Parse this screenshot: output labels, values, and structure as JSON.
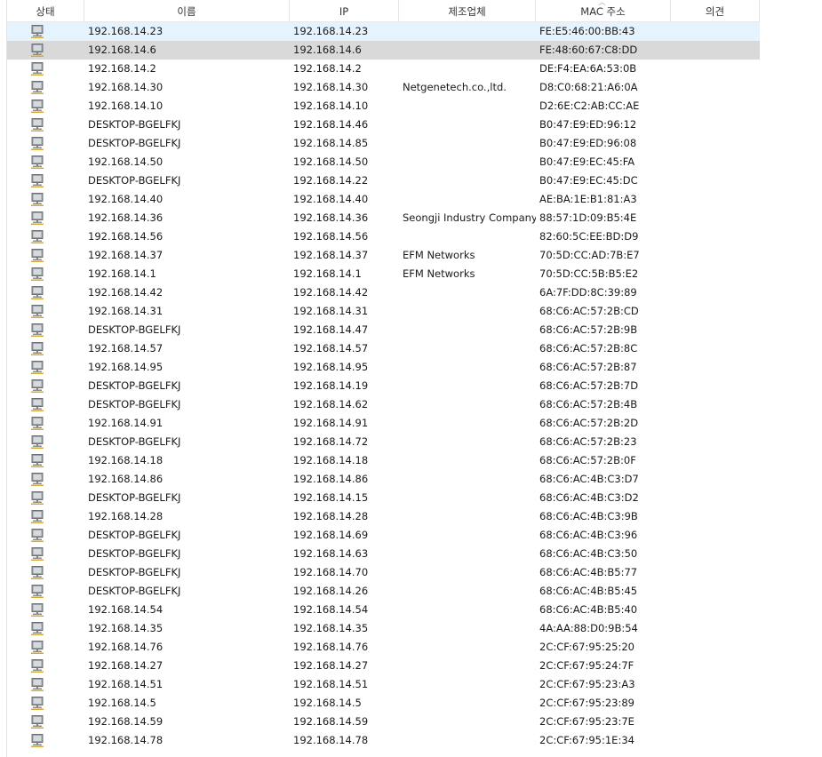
{
  "columns": {
    "status": "상태",
    "name": "이름",
    "ip": "IP",
    "vendor": "제조업체",
    "mac": "MAC 주소",
    "note": "의견"
  },
  "sort_indicator": "︿",
  "status_icon_name": "network-computer-icon",
  "rows": [
    {
      "name": "192.168.14.23",
      "ip": "192.168.14.23",
      "vendor": "",
      "mac": "FE:E5:46:00:BB:43",
      "note": "",
      "state": "hover"
    },
    {
      "name": "192.168.14.6",
      "ip": "192.168.14.6",
      "vendor": "",
      "mac": "FE:48:60:67:C8:DD",
      "note": "",
      "state": "selected"
    },
    {
      "name": "192.168.14.2",
      "ip": "192.168.14.2",
      "vendor": "",
      "mac": "DE:F4:EA:6A:53:0B",
      "note": ""
    },
    {
      "name": "192.168.14.30",
      "ip": "192.168.14.30",
      "vendor": "Netgenetech.co.,ltd.",
      "mac": "D8:C0:68:21:A6:0A",
      "note": ""
    },
    {
      "name": "192.168.14.10",
      "ip": "192.168.14.10",
      "vendor": "",
      "mac": "D2:6E:C2:AB:CC:AE",
      "note": ""
    },
    {
      "name": "DESKTOP-BGELFKJ",
      "ip": "192.168.14.46",
      "vendor": "",
      "mac": "B0:47:E9:ED:96:12",
      "note": ""
    },
    {
      "name": "DESKTOP-BGELFKJ",
      "ip": "192.168.14.85",
      "vendor": "",
      "mac": "B0:47:E9:ED:96:08",
      "note": ""
    },
    {
      "name": "192.168.14.50",
      "ip": "192.168.14.50",
      "vendor": "",
      "mac": "B0:47:E9:EC:45:FA",
      "note": ""
    },
    {
      "name": "DESKTOP-BGELFKJ",
      "ip": "192.168.14.22",
      "vendor": "",
      "mac": "B0:47:E9:EC:45:DC",
      "note": ""
    },
    {
      "name": "192.168.14.40",
      "ip": "192.168.14.40",
      "vendor": "",
      "mac": "AE:BA:1E:B1:81:A3",
      "note": ""
    },
    {
      "name": "192.168.14.36",
      "ip": "192.168.14.36",
      "vendor": "Seongji Industry Company",
      "mac": "88:57:1D:09:B5:4E",
      "note": ""
    },
    {
      "name": "192.168.14.56",
      "ip": "192.168.14.56",
      "vendor": "",
      "mac": "82:60:5C:EE:BD:D9",
      "note": ""
    },
    {
      "name": "192.168.14.37",
      "ip": "192.168.14.37",
      "vendor": "EFM Networks",
      "mac": "70:5D:CC:AD:7B:E7",
      "note": ""
    },
    {
      "name": "192.168.14.1",
      "ip": "192.168.14.1",
      "vendor": "EFM Networks",
      "mac": "70:5D:CC:5B:B5:E2",
      "note": ""
    },
    {
      "name": "192.168.14.42",
      "ip": "192.168.14.42",
      "vendor": "",
      "mac": "6A:7F:DD:8C:39:89",
      "note": ""
    },
    {
      "name": "192.168.14.31",
      "ip": "192.168.14.31",
      "vendor": "",
      "mac": "68:C6:AC:57:2B:CD",
      "note": ""
    },
    {
      "name": "DESKTOP-BGELFKJ",
      "ip": "192.168.14.47",
      "vendor": "",
      "mac": "68:C6:AC:57:2B:9B",
      "note": ""
    },
    {
      "name": "192.168.14.57",
      "ip": "192.168.14.57",
      "vendor": "",
      "mac": "68:C6:AC:57:2B:8C",
      "note": ""
    },
    {
      "name": "192.168.14.95",
      "ip": "192.168.14.95",
      "vendor": "",
      "mac": "68:C6:AC:57:2B:87",
      "note": ""
    },
    {
      "name": "DESKTOP-BGELFKJ",
      "ip": "192.168.14.19",
      "vendor": "",
      "mac": "68:C6:AC:57:2B:7D",
      "note": ""
    },
    {
      "name": "DESKTOP-BGELFKJ",
      "ip": "192.168.14.62",
      "vendor": "",
      "mac": "68:C6:AC:57:2B:4B",
      "note": ""
    },
    {
      "name": "192.168.14.91",
      "ip": "192.168.14.91",
      "vendor": "",
      "mac": "68:C6:AC:57:2B:2D",
      "note": ""
    },
    {
      "name": "DESKTOP-BGELFKJ",
      "ip": "192.168.14.72",
      "vendor": "",
      "mac": "68:C6:AC:57:2B:23",
      "note": ""
    },
    {
      "name": "192.168.14.18",
      "ip": "192.168.14.18",
      "vendor": "",
      "mac": "68:C6:AC:57:2B:0F",
      "note": ""
    },
    {
      "name": "192.168.14.86",
      "ip": "192.168.14.86",
      "vendor": "",
      "mac": "68:C6:AC:4B:C3:D7",
      "note": ""
    },
    {
      "name": "DESKTOP-BGELFKJ",
      "ip": "192.168.14.15",
      "vendor": "",
      "mac": "68:C6:AC:4B:C3:D2",
      "note": ""
    },
    {
      "name": "192.168.14.28",
      "ip": "192.168.14.28",
      "vendor": "",
      "mac": "68:C6:AC:4B:C3:9B",
      "note": ""
    },
    {
      "name": "DESKTOP-BGELFKJ",
      "ip": "192.168.14.69",
      "vendor": "",
      "mac": "68:C6:AC:4B:C3:96",
      "note": ""
    },
    {
      "name": "DESKTOP-BGELFKJ",
      "ip": "192.168.14.63",
      "vendor": "",
      "mac": "68:C6:AC:4B:C3:50",
      "note": ""
    },
    {
      "name": "DESKTOP-BGELFKJ",
      "ip": "192.168.14.70",
      "vendor": "",
      "mac": "68:C6:AC:4B:B5:77",
      "note": ""
    },
    {
      "name": "DESKTOP-BGELFKJ",
      "ip": "192.168.14.26",
      "vendor": "",
      "mac": "68:C6:AC:4B:B5:45",
      "note": ""
    },
    {
      "name": "192.168.14.54",
      "ip": "192.168.14.54",
      "vendor": "",
      "mac": "68:C6:AC:4B:B5:40",
      "note": ""
    },
    {
      "name": "192.168.14.35",
      "ip": "192.168.14.35",
      "vendor": "",
      "mac": "4A:AA:88:D0:9B:54",
      "note": ""
    },
    {
      "name": "192.168.14.76",
      "ip": "192.168.14.76",
      "vendor": "",
      "mac": "2C:CF:67:95:25:20",
      "note": ""
    },
    {
      "name": "192.168.14.27",
      "ip": "192.168.14.27",
      "vendor": "",
      "mac": "2C:CF:67:95:24:7F",
      "note": ""
    },
    {
      "name": "192.168.14.51",
      "ip": "192.168.14.51",
      "vendor": "",
      "mac": "2C:CF:67:95:23:A3",
      "note": ""
    },
    {
      "name": "192.168.14.5",
      "ip": "192.168.14.5",
      "vendor": "",
      "mac": "2C:CF:67:95:23:89",
      "note": ""
    },
    {
      "name": "192.168.14.59",
      "ip": "192.168.14.59",
      "vendor": "",
      "mac": "2C:CF:67:95:23:7E",
      "note": ""
    },
    {
      "name": "192.168.14.78",
      "ip": "192.168.14.78",
      "vendor": "",
      "mac": "2C:CF:67:95:1E:34",
      "note": ""
    }
  ]
}
